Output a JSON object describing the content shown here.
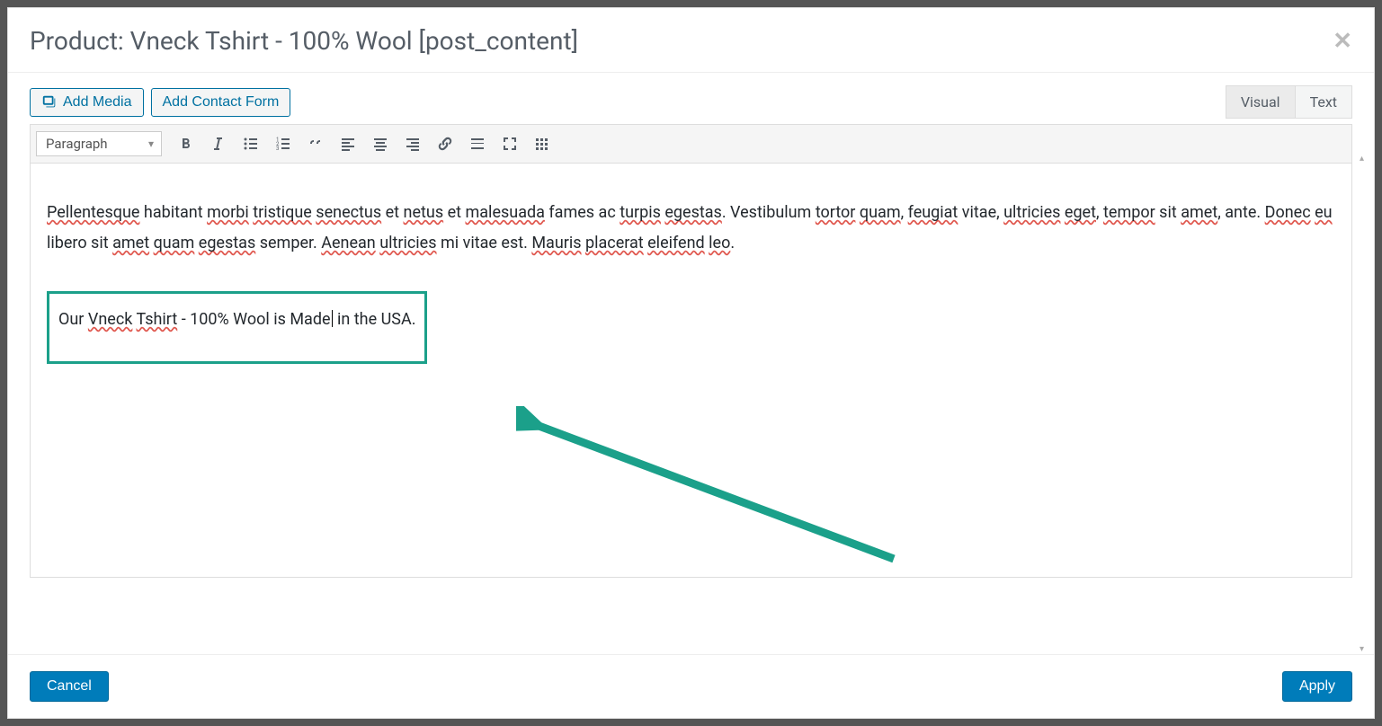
{
  "header": {
    "title": "Product: Vneck Tshirt - 100% Wool [post_content]"
  },
  "media": {
    "add_media": "Add Media",
    "add_contact_form": "Add Contact Form"
  },
  "tabs": {
    "visual": "Visual",
    "text": "Text",
    "active": "visual"
  },
  "toolbar": {
    "format": "Paragraph",
    "buttons": [
      "bold",
      "italic",
      "bullet-list",
      "number-list",
      "blockquote",
      "align-left",
      "align-center",
      "align-right",
      "link",
      "read-more",
      "fullscreen",
      "kitchen-sink"
    ]
  },
  "content": {
    "paragraph1": {
      "segments": [
        {
          "text": "Pellentesque",
          "style": "spellerr"
        },
        {
          "text": " habitant ",
          "style": ""
        },
        {
          "text": "morbi",
          "style": "spellerr"
        },
        {
          "text": " ",
          "style": ""
        },
        {
          "text": "tristique",
          "style": "spellerr"
        },
        {
          "text": " ",
          "style": ""
        },
        {
          "text": "senectus",
          "style": "spellerr"
        },
        {
          "text": " et ",
          "style": ""
        },
        {
          "text": "netus",
          "style": "spellerr"
        },
        {
          "text": " et ",
          "style": ""
        },
        {
          "text": "malesuada",
          "style": "spellerr"
        },
        {
          "text": " fames ac ",
          "style": ""
        },
        {
          "text": "turpis",
          "style": "spellerr"
        },
        {
          "text": " ",
          "style": ""
        },
        {
          "text": "egestas",
          "style": "spellerr"
        },
        {
          "text": ". Vestibulum ",
          "style": ""
        },
        {
          "text": "tortor",
          "style": "spellerr"
        },
        {
          "text": " ",
          "style": ""
        },
        {
          "text": "quam",
          "style": "spellerr"
        },
        {
          "text": ", ",
          "style": ""
        },
        {
          "text": "feugiat",
          "style": "spellerr"
        },
        {
          "text": " vitae, ",
          "style": ""
        },
        {
          "text": "ultricies",
          "style": "spellerr"
        },
        {
          "text": " ",
          "style": ""
        },
        {
          "text": "eget",
          "style": "spellerr"
        },
        {
          "text": ", ",
          "style": ""
        },
        {
          "text": "tempor",
          "style": "spellerr"
        },
        {
          "text": " sit ",
          "style": ""
        },
        {
          "text": "amet",
          "style": "spellerr"
        },
        {
          "text": ", ante. ",
          "style": ""
        },
        {
          "text": "Donec",
          "style": "spellerr"
        },
        {
          "text": " ",
          "style": ""
        },
        {
          "text": "eu",
          "style": "spellerr"
        },
        {
          "text": " libero sit ",
          "style": ""
        },
        {
          "text": "amet",
          "style": "spellerr"
        },
        {
          "text": " ",
          "style": ""
        },
        {
          "text": "quam",
          "style": "spellerr"
        },
        {
          "text": " ",
          "style": ""
        },
        {
          "text": "egestas",
          "style": "spellerr"
        },
        {
          "text": " semper. ",
          "style": ""
        },
        {
          "text": "Aenean",
          "style": "spellerr"
        },
        {
          "text": " ",
          "style": ""
        },
        {
          "text": "ultricies",
          "style": "spellerr"
        },
        {
          "text": " mi vitae est. ",
          "style": ""
        },
        {
          "text": "Mauris",
          "style": "spellerr"
        },
        {
          "text": " ",
          "style": ""
        },
        {
          "text": "placerat",
          "style": "spellerr"
        },
        {
          "text": " ",
          "style": ""
        },
        {
          "text": "eleifend",
          "style": "spellerr"
        },
        {
          "text": " ",
          "style": ""
        },
        {
          "text": "leo",
          "style": "spellerr"
        },
        {
          "text": ".",
          "style": ""
        }
      ]
    },
    "paragraph2": {
      "segments": [
        {
          "text": "Our ",
          "style": ""
        },
        {
          "text": "Vneck",
          "style": "spellerr"
        },
        {
          "text": " ",
          "style": ""
        },
        {
          "text": "Tshirt",
          "style": "spellerr"
        },
        {
          "text": " - 100% Wool is Made",
          "style": ""
        },
        {
          "text": "",
          "style": "cursor"
        },
        {
          "text": " in the USA.",
          "style": ""
        }
      ]
    }
  },
  "footer": {
    "cancel": "Cancel",
    "apply": "Apply"
  },
  "colors": {
    "accent_green": "#1ba08a",
    "link_blue": "#0071a1",
    "primary_blue": "#007cba"
  }
}
